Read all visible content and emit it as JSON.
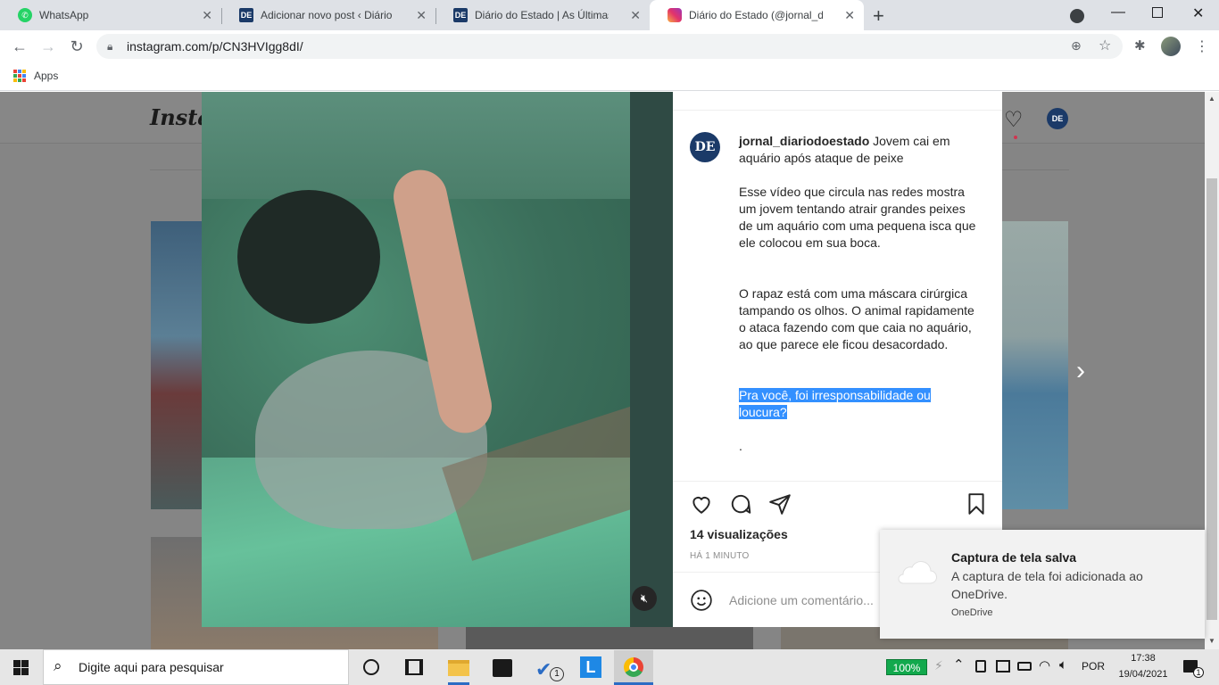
{
  "tabs": [
    {
      "title": "WhatsApp",
      "favicon": "whatsapp-icon"
    },
    {
      "title": "Adicionar novo post ‹ Diário do E",
      "favicon": "DE"
    },
    {
      "title": "Diário do Estado | As Últimas Not",
      "favicon": "DE"
    },
    {
      "title": "Diário do Estado (@jornal_diario",
      "favicon": "instagram-icon"
    }
  ],
  "address_bar": {
    "url": "instagram.com/p/CN3HVIgg8dI/"
  },
  "bookmarks": {
    "apps_label": "Apps"
  },
  "instagram": {
    "logo_partial": "Insta",
    "avatar_text": "DE",
    "post": {
      "username": "jornal_diariodoestado",
      "caption_first_line": "Jovem cai em aquário após ataque de peixe",
      "paragraph_1": "Esse vídeo que circula nas redes mostra um jovem tentando atrair grandes peixes de um aquário com uma pequena isca que ele colocou em sua boca.",
      "paragraph_2": "O rapaz está com uma máscara cirúrgica tampando os olhos. O animal rapidamente o ataca fazendo com que caia no aquário, ao que parece ele ficou desacordado.",
      "highlighted_question": "Pra você, foi irresponsabilidade ou loucura?",
      "trailing_dot": ".",
      "views": "14 visualizações",
      "time_ago": "HÁ 1 MINUTO",
      "comment_placeholder": "Adicione um comentário..."
    }
  },
  "notification": {
    "title": "Captura de tela salva",
    "body": "A captura de tela foi adicionada ao OneDrive.",
    "app": "OneDrive"
  },
  "taskbar": {
    "search_placeholder": "Digite aqui para pesquisar",
    "battery": "100%",
    "language": "POR",
    "time": "17:38",
    "date": "19/04/2021",
    "badge_count": "1",
    "notification_count": "1"
  },
  "colors": {
    "highlight": "#3390ff",
    "instagram_text": "#262626",
    "secondary_text": "#8e8e8e",
    "overlay": "#858585"
  }
}
